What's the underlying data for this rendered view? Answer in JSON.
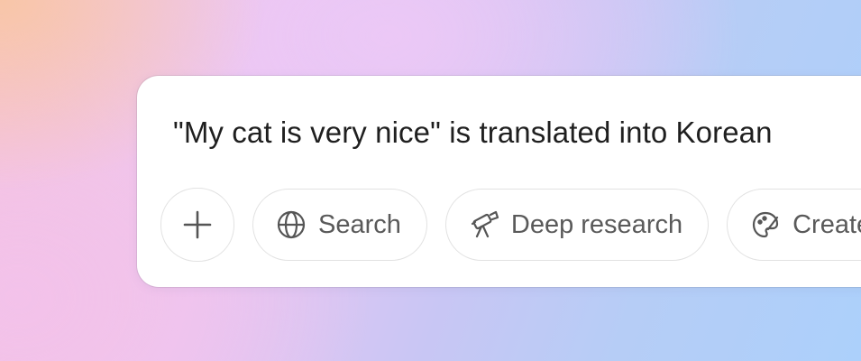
{
  "composer": {
    "prompt_text": "\"My cat is very nice\" is translated into Korean",
    "buttons": [
      {
        "label": "",
        "icon": "plus-icon"
      },
      {
        "label": "Search",
        "icon": "globe-icon"
      },
      {
        "label": "Deep research",
        "icon": "telescope-icon"
      },
      {
        "label": "Create image",
        "icon": "palette-icon"
      }
    ]
  }
}
